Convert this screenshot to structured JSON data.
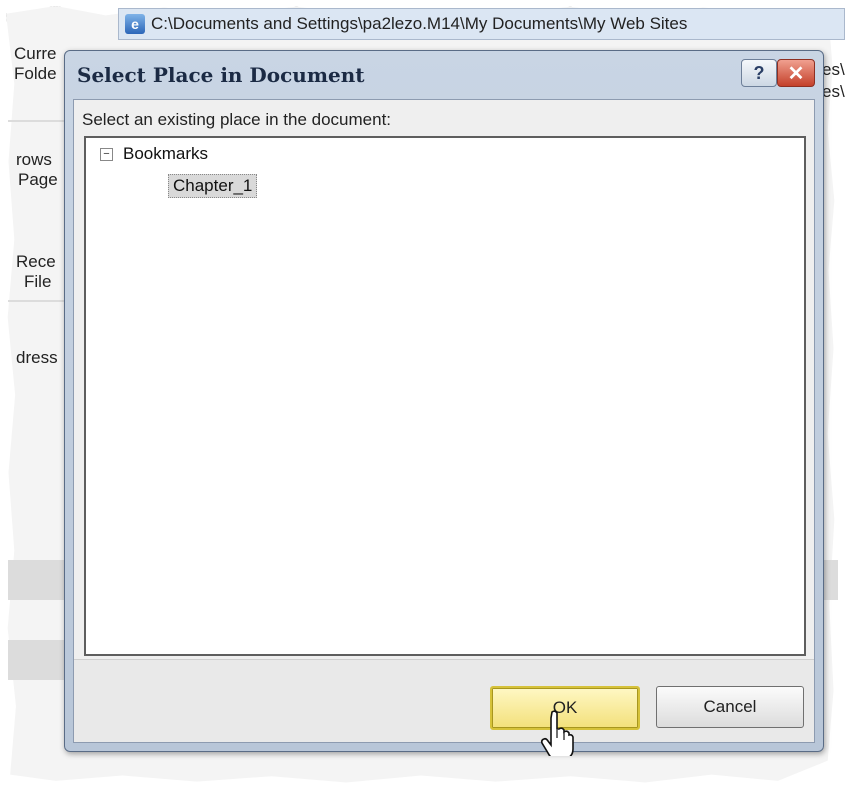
{
  "background": {
    "window_title": "C:\\Documents and Settings\\pa2lezo.M14\\My Documents\\My Web Sites",
    "left_fragments": [
      "Curre",
      "Folde",
      "rows",
      "Page",
      "Rece",
      "File",
      "dress"
    ],
    "right_fragments": [
      "es\\",
      "es\\"
    ]
  },
  "dialog": {
    "title": "Select Place in Document",
    "help_label": "?",
    "close_label": "✕",
    "prompt": "Select an existing place in the document:",
    "tree": {
      "root_label": "Bookmarks",
      "expander_symbol": "−",
      "children": [
        "Chapter_1"
      ]
    },
    "ok_label": "OK",
    "cancel_label": "Cancel"
  },
  "colors": {
    "ok_highlight": "#f3e07a",
    "close_red": "#c4402a"
  }
}
